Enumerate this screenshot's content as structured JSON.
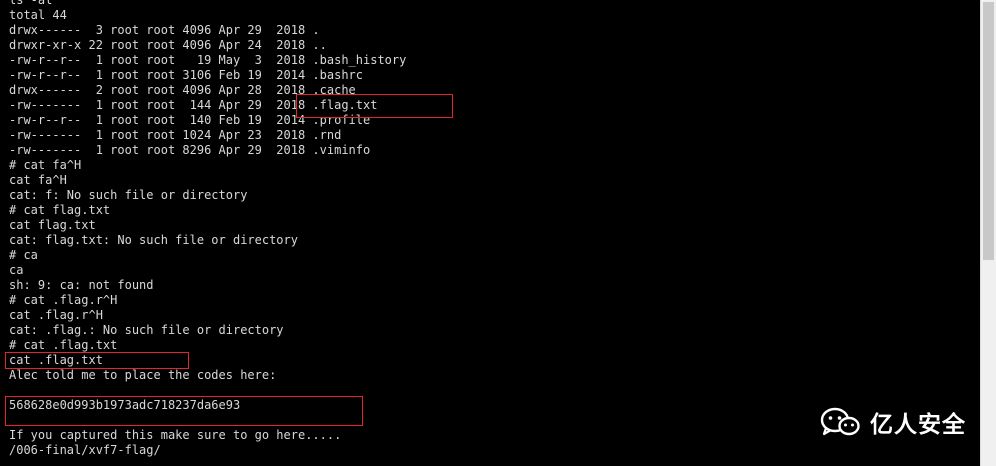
{
  "terminal": {
    "lines": [
      "ls -al",
      "total 44",
      "drwx------  3 root root 4096 Apr 29  2018 .",
      "drwxr-xr-x 22 root root 4096 Apr 24  2018 ..",
      "-rw-r--r--  1 root root   19 May  3  2018 .bash_history",
      "-rw-r--r--  1 root root 3106 Feb 19  2014 .bashrc",
      "drwx------  2 root root 4096 Apr 28  2018 .cache",
      "-rw-------  1 root root  144 Apr 29  2018 .flag.txt",
      "-rw-r--r--  1 root root  140 Feb 19  2014 .profile",
      "-rw-------  1 root root 1024 Apr 23  2018 .rnd",
      "-rw-------  1 root root 8296 Apr 29  2018 .viminfo",
      "# cat fa^H",
      "cat fa^H",
      "cat: f: No such file or directory",
      "# cat flag.txt",
      "cat flag.txt",
      "cat: flag.txt: No such file or directory",
      "# ca",
      "ca",
      "sh: 9: ca: not found",
      "# cat .flag.r^H",
      "cat .flag.r^H",
      "cat: .flag.: No such file or directory",
      "# cat .flag.txt",
      "cat .flag.txt",
      "Alec told me to place the codes here:",
      "",
      "568628e0d993b1973adc718237da6e93",
      "",
      "If you captured this make sure to go here.....",
      "/006-final/xvf7-flag/"
    ]
  },
  "watermark": {
    "icon": "wechat-icon",
    "text": "亿人安全"
  },
  "colors": {
    "terminal_bg": "#000000",
    "terminal_text": "#d8d8d8",
    "highlight": "#e0262f"
  }
}
